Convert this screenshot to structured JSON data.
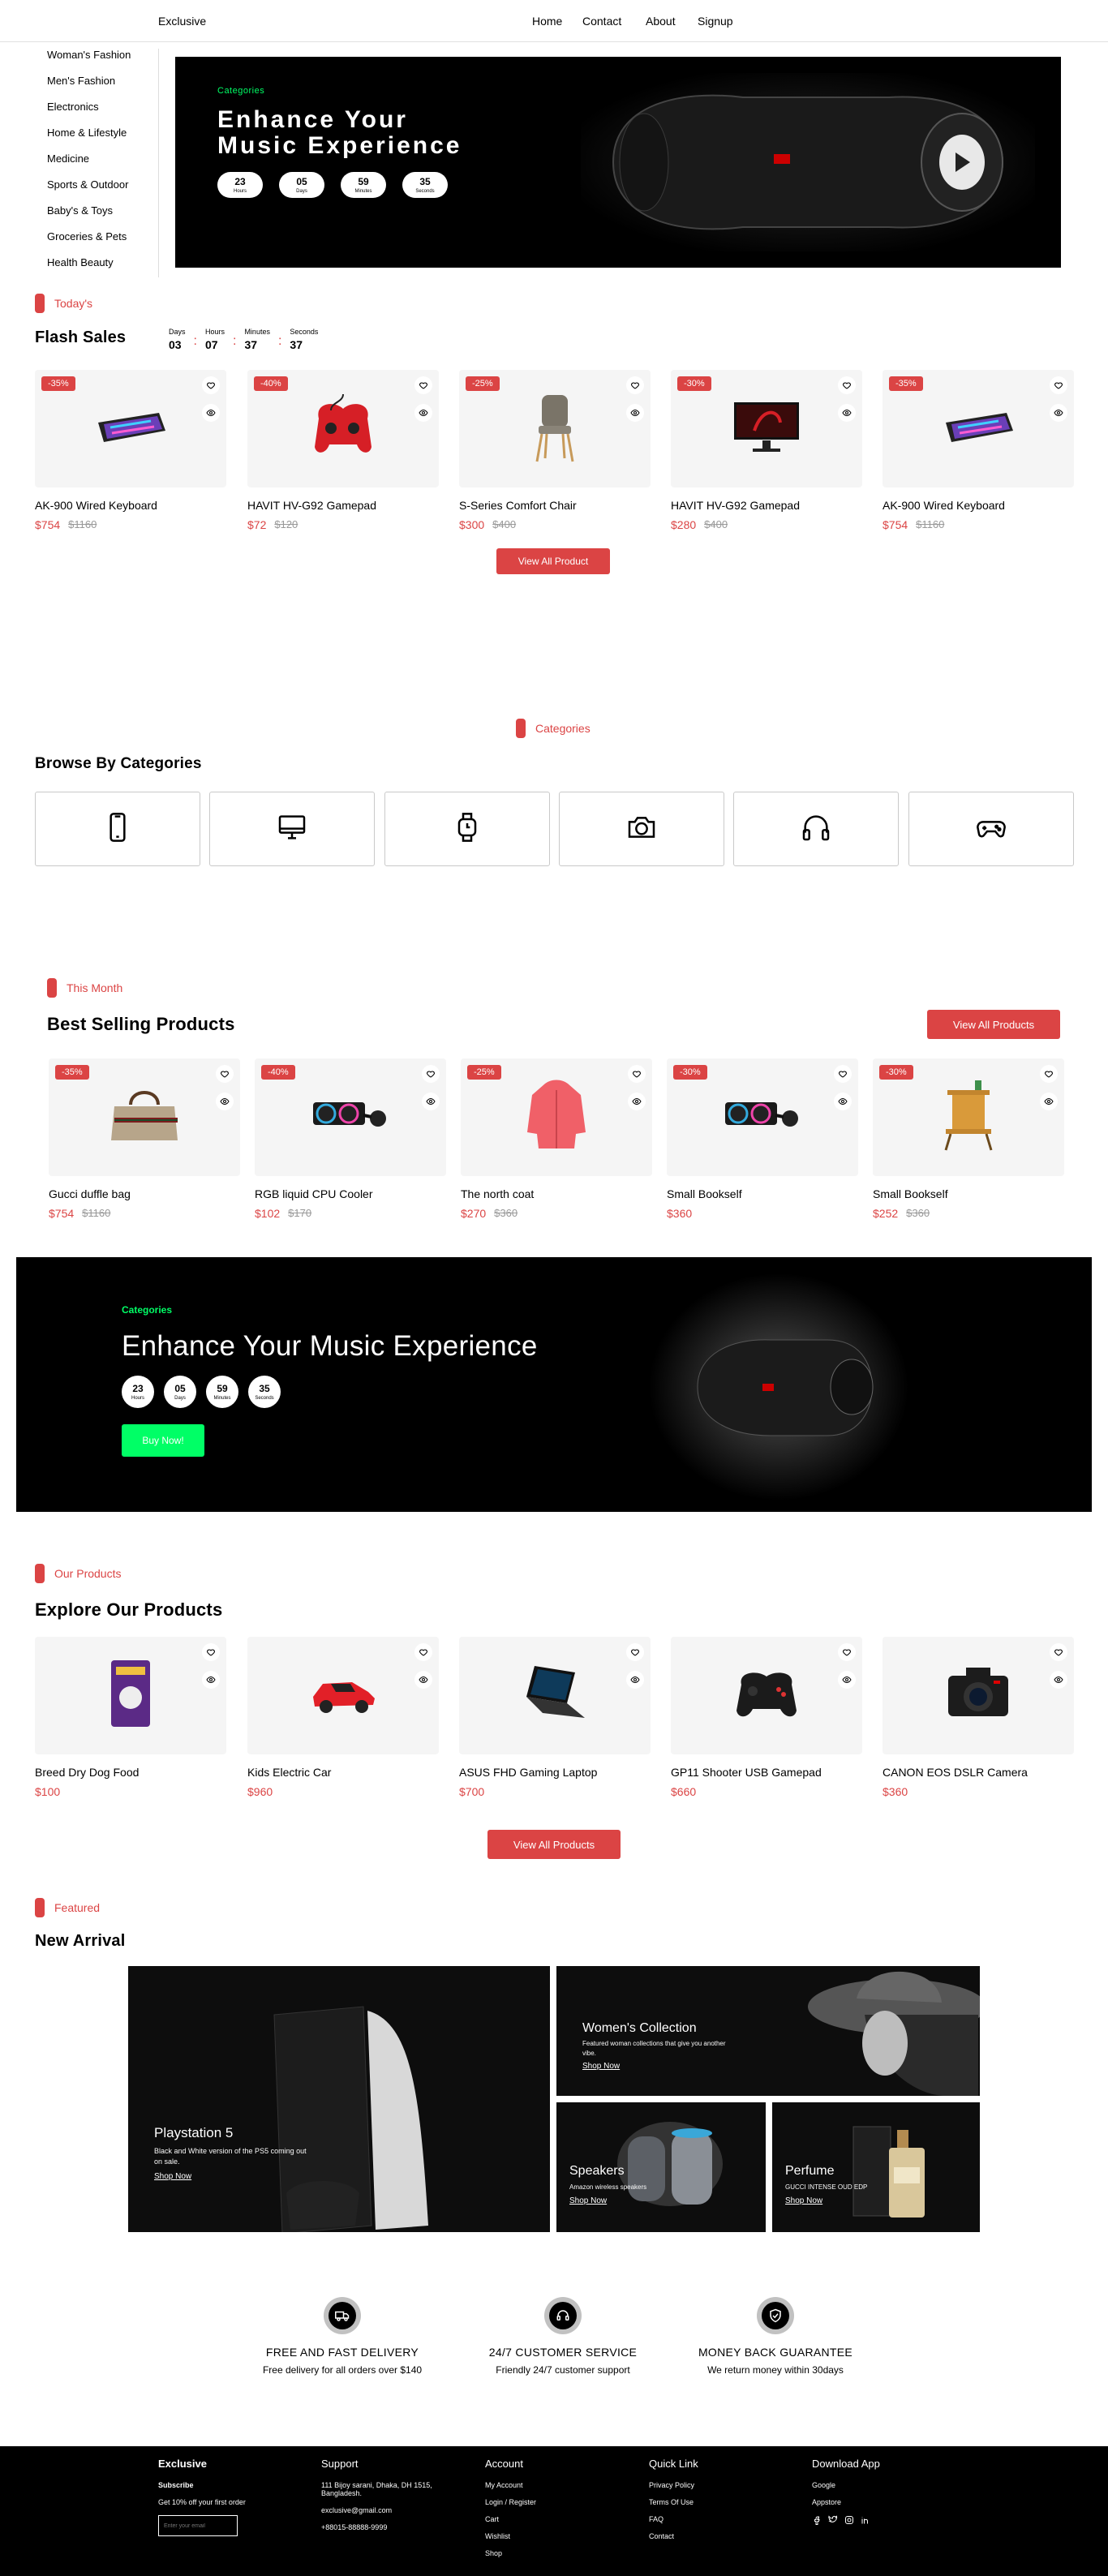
{
  "nav": {
    "logo": "Exclusive",
    "links": [
      "Home",
      "Contact",
      "About",
      "Signup"
    ]
  },
  "sidebar": {
    "items": [
      "Woman's Fashion",
      "Men's Fashion",
      "Electronics",
      "Home & Lifestyle",
      "Medicine",
      "Sports & Outdoor",
      "Baby's & Toys",
      "Groceries & Pets",
      "Health Beauty"
    ]
  },
  "hero": {
    "tag": "Categories",
    "title_line1": "Enhance Your",
    "title_line2": "Music Experience",
    "counters": [
      {
        "value": "23",
        "label": "Hours"
      },
      {
        "value": "05",
        "label": "Days"
      },
      {
        "value": "59",
        "label": "Minutes"
      },
      {
        "value": "35",
        "label": "Seconds"
      }
    ]
  },
  "flash": {
    "tag": "Today's",
    "title": "Flash Sales",
    "timer": [
      {
        "label": "Days",
        "value": "03"
      },
      {
        "label": "Hours",
        "value": "07"
      },
      {
        "label": "Minutes",
        "value": "37"
      },
      {
        "label": "Seconds",
        "value": "37"
      }
    ],
    "products": [
      {
        "discount": "-35%",
        "name": "AK-900 Wired Keyboard",
        "price": "$754",
        "old": "$1160",
        "icon": "keyboard"
      },
      {
        "discount": "-40%",
        "name": "HAVIT HV-G92 Gamepad",
        "price": "$72",
        "old": "$120",
        "icon": "gamepad"
      },
      {
        "discount": "-25%",
        "name": "S-Series Comfort Chair",
        "price": "$300",
        "old": "$400",
        "icon": "chair"
      },
      {
        "discount": "-30%",
        "name": "HAVIT HV-G92 Gamepad",
        "price": "$280",
        "old": "$400",
        "icon": "monitor"
      },
      {
        "discount": "-35%",
        "name": "AK-900 Wired Keyboard",
        "price": "$754",
        "old": "$1160",
        "icon": "keyboard"
      }
    ],
    "view_all": "View All Product"
  },
  "categories": {
    "tag": "Categories",
    "title": "Browse By Categories",
    "icons": [
      "phone",
      "computer",
      "smartwatch",
      "camera",
      "headphones",
      "gamepad"
    ]
  },
  "best": {
    "tag": "This Month",
    "title": "Best Selling Products",
    "view_all": "View All Products",
    "products": [
      {
        "discount": "-35%",
        "name": "Gucci duffle bag",
        "price": "$754",
        "old": "$1160",
        "icon": "bag"
      },
      {
        "discount": "-40%",
        "name": "RGB liquid CPU Cooler",
        "price": "$102",
        "old": "$170",
        "icon": "cooler"
      },
      {
        "discount": "-25%",
        "name": "The north coat",
        "price": "$270",
        "old": "$360",
        "icon": "coat"
      },
      {
        "discount": "-30%",
        "name": "Small Bookself",
        "price": "$360",
        "old": "",
        "icon": "cooler"
      },
      {
        "discount": "-30%",
        "name": "Small Bookself",
        "price": "$252",
        "old": "$360",
        "icon": "bookshelf"
      }
    ]
  },
  "promo": {
    "tag": "Categories",
    "title": "Enhance Your Music Experience",
    "counters": [
      {
        "value": "23",
        "label": "Hours"
      },
      {
        "value": "05",
        "label": "Days"
      },
      {
        "value": "59",
        "label": "Minutes"
      },
      {
        "value": "35",
        "label": "Seconds"
      }
    ],
    "button": "Buy Now!"
  },
  "explore": {
    "tag": "Our Products",
    "title": "Explore Our Products",
    "view_all": "View All Products",
    "products": [
      {
        "name": "Breed Dry Dog Food",
        "price": "$100",
        "icon": "dogfood"
      },
      {
        "name": "Kids Electric Car",
        "price": "$960",
        "icon": "car"
      },
      {
        "name": "ASUS FHD Gaming Laptop",
        "price": "$700",
        "icon": "laptop"
      },
      {
        "name": "GP11 Shooter USB Gamepad",
        "price": "$660",
        "icon": "gamepad-black"
      },
      {
        "name": "CANON EOS DSLR Camera",
        "price": "$360",
        "icon": "camera"
      }
    ]
  },
  "arrival": {
    "tag": "Featured",
    "title": "New Arrival",
    "ps5": {
      "title": "Playstation 5",
      "desc": "Black and White version of the PS5 coming out on sale.",
      "link": "Shop Now"
    },
    "women": {
      "title": "Women's Collection",
      "desc": "Featured woman collections that give you another vibe.",
      "link": "Shop Now"
    },
    "speakers": {
      "title": "Speakers",
      "desc": "Amazon wireless speakers",
      "link": "Shop Now"
    },
    "perfume": {
      "title": "Perfume",
      "desc": "GUCCI INTENSE OUD EDP",
      "link": "Shop Now"
    }
  },
  "services": [
    {
      "title": "FREE AND FAST DELIVERY",
      "desc": "Free delivery for all orders over $140",
      "icon": "truck-icon"
    },
    {
      "title": "24/7 CUSTOMER SERVICE",
      "desc": "Friendly 24/7 customer support",
      "icon": "headset-icon"
    },
    {
      "title": "MONEY BACK GUARANTEE",
      "desc": "We return money within 30days",
      "icon": "shield-icon"
    }
  ],
  "footer": {
    "brand": {
      "title": "Exclusive",
      "sub": "Subscribe",
      "offer": "Get 10% off your first order",
      "placeholder": "Enter your email"
    },
    "support": {
      "title": "Support",
      "address": "111 Bijoy sarani, Dhaka, DH 1515, Bangladesh.",
      "email": "exclusive@gmail.com",
      "phone": "+88015-88888-9999"
    },
    "account": {
      "title": "Account",
      "links": [
        "My Account",
        "Login / Register",
        "Cart",
        "Wishlist",
        "Shop"
      ]
    },
    "quick": {
      "title": "Quick Link",
      "links": [
        "Privacy Policy",
        "Terms Of Use",
        "FAQ",
        "Contact"
      ]
    },
    "download": {
      "title": "Download App",
      "google": "Google",
      "appstore": "Appstore"
    }
  },
  "colors": {
    "accent": "#db4444",
    "green": "#00ff66",
    "dark": "#000000"
  }
}
